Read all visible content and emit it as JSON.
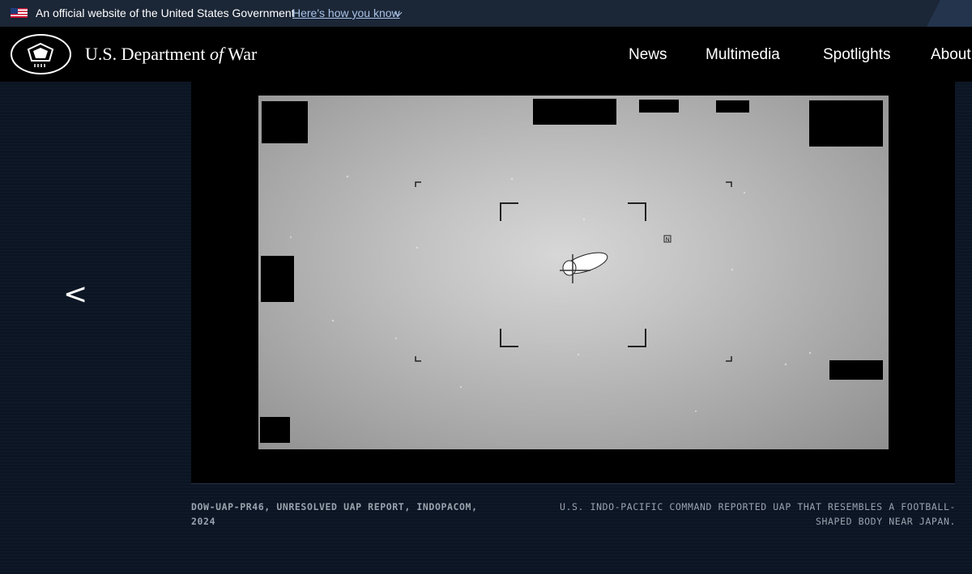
{
  "banner": {
    "official_text": "An official website of the United States Government",
    "how_you_know": "Here's how you know"
  },
  "header": {
    "title_prefix": "U.S. Department",
    "title_of": "of",
    "title_suffix": "War",
    "nav": [
      "News",
      "Multimedia",
      "Spotlights",
      "About"
    ]
  },
  "carousel": {
    "prev_label": "<",
    "caption_title": "DOW-UAP-PR46, UNRESOLVED UAP REPORT, INDOPACOM, 2024",
    "caption_description": "U.S. INDO-PACIFIC COMMAND REPORTED UAP THAT RESEMBLES A FOOTBALL-SHAPED BODY NEAR JAPAN."
  },
  "icons": {
    "flag": "us-flag-icon",
    "logo": "pentagon-logo-icon",
    "chevron": "chevron-down-icon"
  },
  "colors": {
    "banner_bg": "#1b2636",
    "header_bg": "#000000",
    "link": "#a9c3e8",
    "caption": "#9aa3ae"
  }
}
